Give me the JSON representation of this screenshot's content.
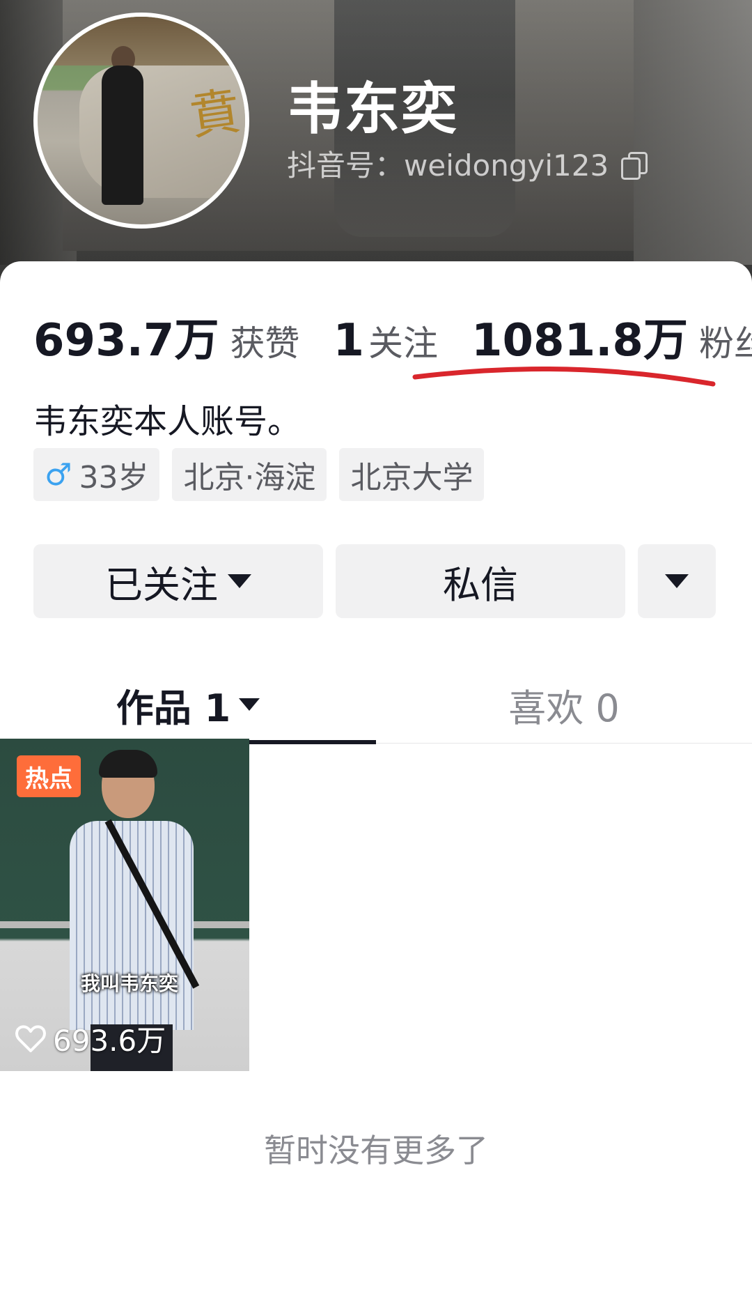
{
  "profile": {
    "name": "韦东奕",
    "douyin_id": "抖音号：weidongyi123",
    "bio": "韦东奕本人账号。"
  },
  "stats": {
    "likes_value": "693.7万",
    "likes_label": "获赞",
    "following_value": "1",
    "following_label": "关注",
    "followers_value": "1081.8万",
    "followers_label": "粉丝"
  },
  "tags": {
    "gender_icon": "♂",
    "age": "33岁",
    "location": "北京·海淀",
    "school": "北京大学"
  },
  "actions": {
    "follow_label": "已关注",
    "message_label": "私信"
  },
  "tabs": {
    "works_label": "作品 1",
    "likes_label": "喜欢 0"
  },
  "videos": [
    {
      "badge": "热点",
      "caption": "我叫韦东奕",
      "likes": "693.6万"
    }
  ],
  "footer": {
    "no_more": "暂时没有更多了"
  },
  "colors": {
    "hot_badge": "#fe6d3a",
    "underline_annotation": "#d9262c",
    "male_icon": "#3ba2f0"
  }
}
